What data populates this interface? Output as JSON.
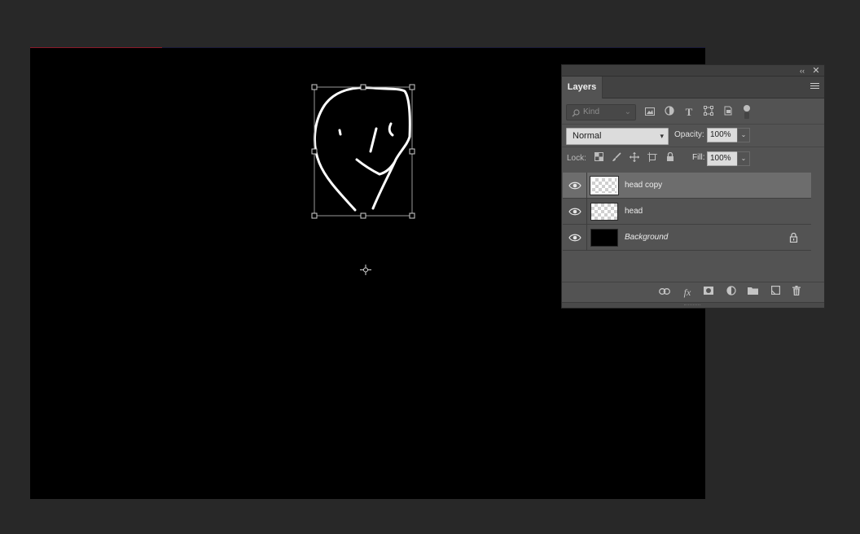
{
  "layers_panel": {
    "tab_label": "Layers",
    "collapse_glyph": "‹‹",
    "close_glyph": "✕",
    "filter": {
      "kind_label": "Kind",
      "icons": [
        "image-filter-icon",
        "adjustment-filter-icon",
        "type-filter-icon",
        "shape-filter-icon",
        "smart-object-filter-icon"
      ]
    },
    "blend_mode": "Normal",
    "opacity_label": "Opacity:",
    "opacity_value": "100%",
    "lock_label": "Lock:",
    "fill_label": "Fill:",
    "fill_value": "100%",
    "layers": [
      {
        "name": "head copy",
        "visible": true,
        "selected": true,
        "thumbnail": "transparent",
        "locked": false
      },
      {
        "name": "head",
        "visible": true,
        "selected": false,
        "thumbnail": "transparent",
        "locked": false
      },
      {
        "name": "Background",
        "visible": true,
        "selected": false,
        "thumbnail": "black",
        "locked": true
      }
    ],
    "bottom_tools": [
      "link-layers-icon",
      "layer-style-icon",
      "add-mask-icon",
      "new-adjustment-icon",
      "new-group-icon",
      "new-layer-icon",
      "delete-layer-icon"
    ]
  },
  "colors": {
    "workspace": "#282828",
    "canvas": "#000000",
    "panel": "#535353",
    "selected_layer": "#6d6d6d"
  }
}
